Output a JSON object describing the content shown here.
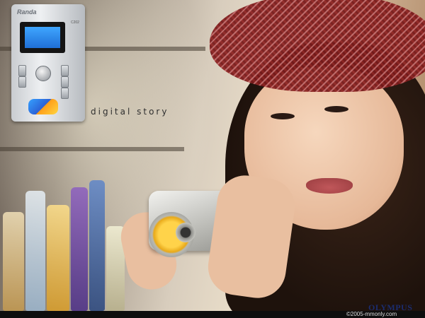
{
  "photo": {
    "subject": "woman-with-camera",
    "device_brand": "Randa",
    "device_model": "C202",
    "tagline": "digital story",
    "copyright": "©2005-mmonly.com",
    "brand_logo": "OLYMPUS"
  },
  "colors": {
    "hat": "#b65a5a",
    "lcd": "#2f86ef",
    "lens_accent": "#f5c21e",
    "logo": "#1b2c6e"
  }
}
